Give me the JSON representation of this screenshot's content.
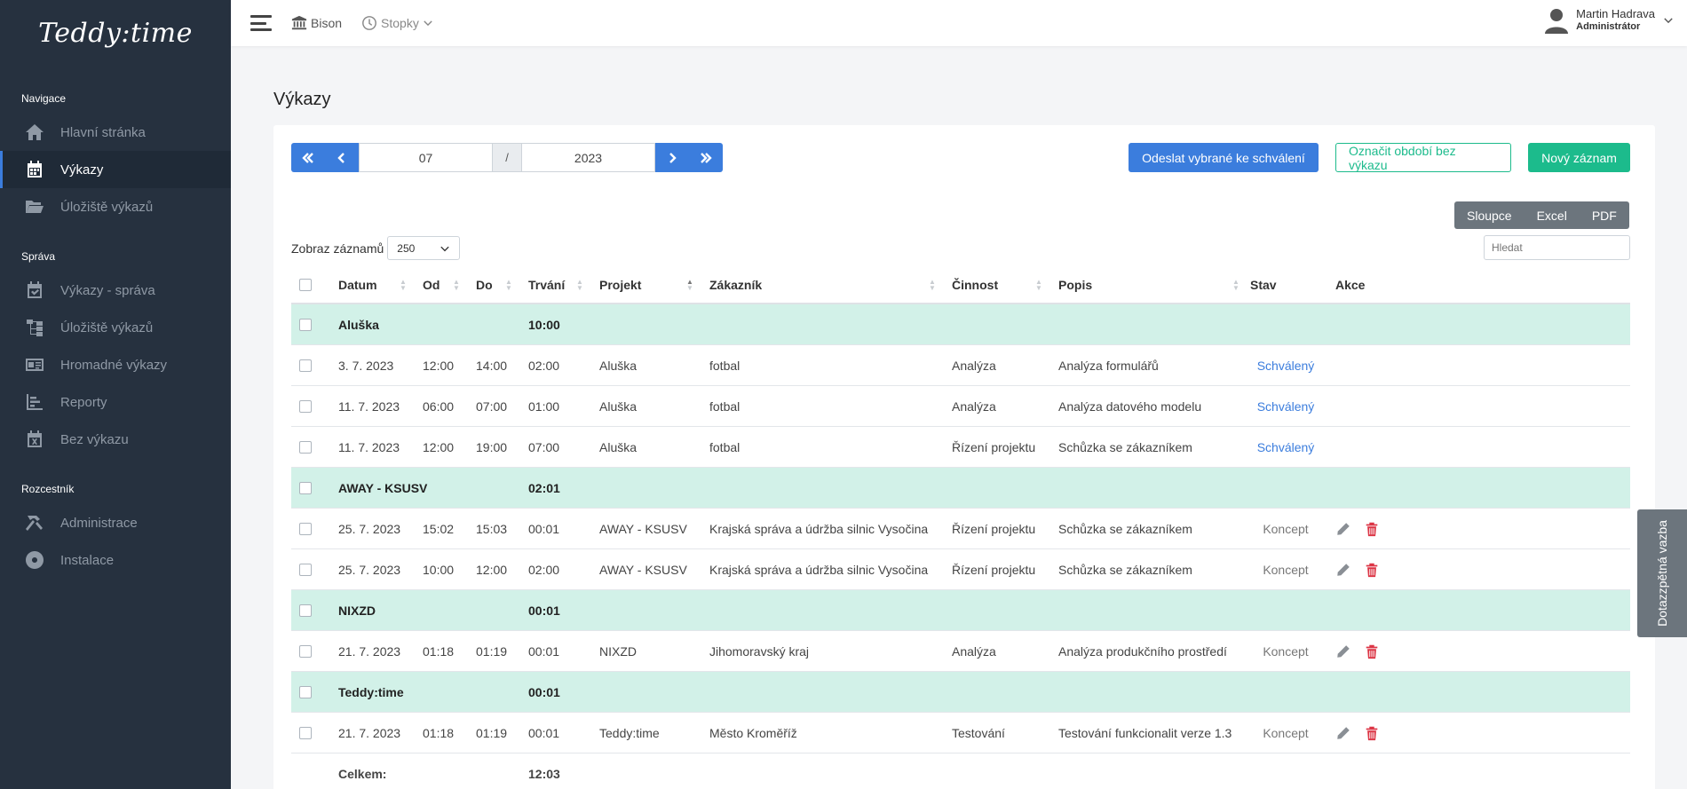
{
  "app": {
    "logo": "Teddy:time"
  },
  "sidebar": {
    "sections": [
      {
        "title": "Navigace",
        "items": [
          {
            "label": "Hlavní stránka",
            "icon": "home-icon"
          },
          {
            "label": "Výkazy",
            "icon": "calendar-icon",
            "active": true
          },
          {
            "label": "Úložiště výkazů",
            "icon": "folder-open-icon"
          }
        ]
      },
      {
        "title": "Správa",
        "items": [
          {
            "label": "Výkazy - správa",
            "icon": "calendar-check-icon"
          },
          {
            "label": "Úložiště výkazů",
            "icon": "sitemap-icon"
          },
          {
            "label": "Hromadné výkazy",
            "icon": "id-card-icon"
          },
          {
            "label": "Reporty",
            "icon": "bar-chart-icon"
          },
          {
            "label": "Bez výkazu",
            "icon": "calendar-x-icon"
          }
        ]
      },
      {
        "title": "Rozcestník",
        "items": [
          {
            "label": "Administrace",
            "icon": "hammer-icon"
          },
          {
            "label": "Instalace",
            "icon": "disc-icon"
          }
        ]
      }
    ]
  },
  "topbar": {
    "org": "Bison",
    "stopwatch": "Stopky",
    "user_name": "Martin Hadrava",
    "user_role": "Administrátor"
  },
  "page": {
    "title": "Výkazy"
  },
  "period": {
    "month": "07",
    "separator": "/",
    "year": "2023"
  },
  "actions": {
    "send_selected": "Odeslat vybrané ke schválení",
    "mark_period": "Označit období bez výkazu",
    "new_record": "Nový záznam"
  },
  "exports": {
    "columns": "Sloupce",
    "excel": "Excel",
    "pdf": "PDF"
  },
  "list": {
    "show_label": "Zobraz záznamů",
    "page_size": "250",
    "search_placeholder": "Hledat"
  },
  "table": {
    "headers": {
      "date": "Datum",
      "from": "Od",
      "to": "Do",
      "duration": "Trvání",
      "project": "Projekt",
      "customer": "Zákazník",
      "activity": "Činnost",
      "description": "Popis",
      "status": "Stav",
      "actions": "Akce"
    },
    "rows": [
      {
        "type": "group",
        "project": "Aluška",
        "duration": "10:00"
      },
      {
        "type": "item",
        "date": "3. 7. 2023",
        "from": "12:00",
        "to": "14:00",
        "duration": "02:00",
        "project": "Aluška",
        "customer": "fotbal",
        "activity": "Analýza",
        "description": "Analýza formulářů",
        "status": "Schválený",
        "editable": false
      },
      {
        "type": "item",
        "date": "11. 7. 2023",
        "from": "06:00",
        "to": "07:00",
        "duration": "01:00",
        "project": "Aluška",
        "customer": "fotbal",
        "activity": "Analýza",
        "description": "Analýza datového modelu",
        "status": "Schválený",
        "editable": false
      },
      {
        "type": "item",
        "date": "11. 7. 2023",
        "from": "12:00",
        "to": "19:00",
        "duration": "07:00",
        "project": "Aluška",
        "customer": "fotbal",
        "activity": "Řízení projektu",
        "description": "Schůzka se zákazníkem",
        "status": "Schválený",
        "editable": false
      },
      {
        "type": "group",
        "project": "AWAY - KSUSV",
        "duration": "02:01"
      },
      {
        "type": "item",
        "date": "25. 7. 2023",
        "from": "15:02",
        "to": "15:03",
        "duration": "00:01",
        "project": "AWAY - KSUSV",
        "customer": "Krajská správa a údržba silnic Vysočina",
        "activity": "Řízení projektu",
        "description": "Schůzka se zákazníkem",
        "status": "Koncept",
        "editable": true
      },
      {
        "type": "item",
        "date": "25. 7. 2023",
        "from": "10:00",
        "to": "12:00",
        "duration": "02:00",
        "project": "AWAY - KSUSV",
        "customer": "Krajská správa a údržba silnic Vysočina",
        "activity": "Řízení projektu",
        "description": "Schůzka se zákazníkem",
        "status": "Koncept",
        "editable": true
      },
      {
        "type": "group",
        "project": "NIXZD",
        "duration": "00:01"
      },
      {
        "type": "item",
        "date": "21. 7. 2023",
        "from": "01:18",
        "to": "01:19",
        "duration": "00:01",
        "project": "NIXZD",
        "customer": "Jihomoravský kraj",
        "activity": "Analýza",
        "description": "Analýza produkčního prostředí",
        "status": "Koncept",
        "editable": true
      },
      {
        "type": "group",
        "project": "Teddy:time",
        "duration": "00:01"
      },
      {
        "type": "item",
        "date": "21. 7. 2023",
        "from": "01:18",
        "to": "01:19",
        "duration": "00:01",
        "project": "Teddy:time",
        "customer": "Město Kroměříž",
        "activity": "Testování",
        "description": "Testování funkcionalit verze 1.3",
        "status": "Koncept",
        "editable": true
      }
    ],
    "total_label": "Celkem:",
    "total_duration": "12:03"
  },
  "feedback_tab": "Dotazzpětná vazba",
  "colors": {
    "sidebar": "#26313f",
    "primary": "#3b7ddd",
    "success": "#1cbb8c",
    "group_row": "#d2f1e8",
    "danger": "#dc3545"
  }
}
